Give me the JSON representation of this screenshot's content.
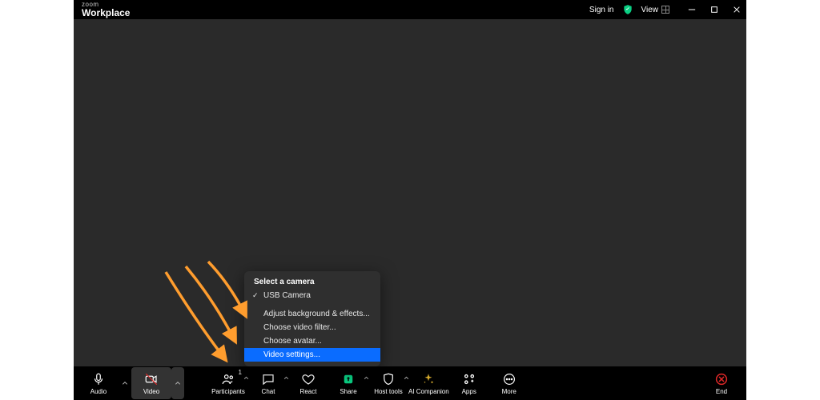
{
  "brand": {
    "top": "zoom",
    "bottom": "Workplace"
  },
  "titlebar": {
    "sign_in": "Sign in",
    "view": "View"
  },
  "popup": {
    "title": "Select a camera",
    "camera": "USB Camera",
    "bg_effects": "Adjust background & effects...",
    "filter": "Choose video filter...",
    "avatar": "Choose avatar...",
    "settings": "Video settings..."
  },
  "toolbar": {
    "audio": "Audio",
    "video": "Video",
    "participants": "Participants",
    "participants_count": "1",
    "chat": "Chat",
    "react": "React",
    "share": "Share",
    "host_tools": "Host tools",
    "ai_companion": "AI Companion",
    "apps": "Apps",
    "more": "More",
    "end": "End"
  }
}
